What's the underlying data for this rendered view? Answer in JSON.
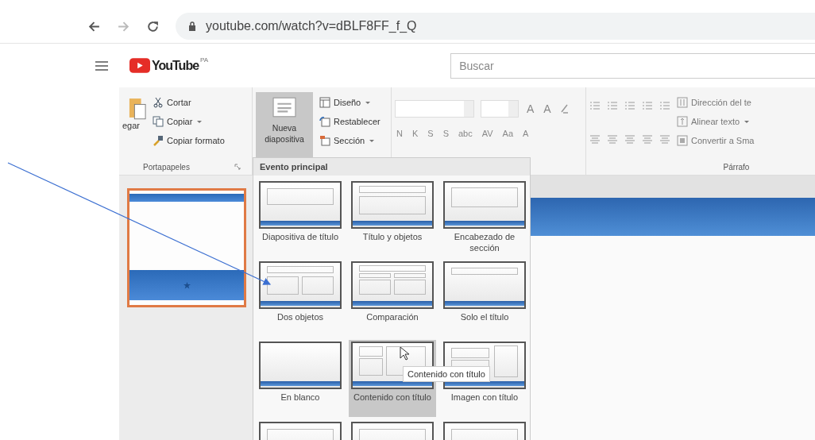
{
  "browser": {
    "url": "youtube.com/watch?v=dBLF8FF_f_Q"
  },
  "youtube": {
    "logo": "YouTube",
    "region": "PA",
    "search": {
      "placeholder": "Buscar"
    }
  },
  "video": {
    "ribbon": {
      "clipboard": {
        "paste_label": "egar",
        "title": "Portapapeles",
        "items": [
          {
            "label": "Cortar",
            "kind": "cut",
            "dropdown": false
          },
          {
            "label": "Copiar",
            "kind": "copy",
            "dropdown": true
          },
          {
            "label": "Copiar formato",
            "kind": "brush",
            "dropdown": false
          }
        ]
      },
      "slides": {
        "new_slide": {
          "label": "Nueva diapositiva",
          "active": true
        },
        "items": [
          {
            "label": "Diseño",
            "kind": "layout",
            "dropdown": true
          },
          {
            "label": "Restablecer",
            "kind": "reset",
            "dropdown": false
          },
          {
            "label": "Sección",
            "kind": "section",
            "dropdown": true
          }
        ]
      },
      "font": {
        "size_buttons": [
          "A",
          "A"
        ],
        "format_buttons": [
          "N",
          "K",
          "S",
          "S",
          "abc",
          "AV",
          "Aa",
          "A"
        ]
      },
      "paragraph": {
        "title": "Párrafo",
        "commands": [
          {
            "label": "Dirección del te",
            "kind": "direction",
            "dropdown": false
          },
          {
            "label": "Alinear texto",
            "kind": "align",
            "dropdown": true
          },
          {
            "label": "Convertir a Sma",
            "kind": "smartart",
            "dropdown": false
          }
        ]
      }
    },
    "slide_panel": {
      "thumbnails": [
        {
          "selected": true
        }
      ]
    },
    "gallery": {
      "heading": "Evento principal",
      "tooltip": "Contenido con título",
      "layouts": [
        {
          "label": "Diapositiva de título",
          "kind": "title",
          "selected": false
        },
        {
          "label": "Título y objetos",
          "kind": "title-content",
          "selected": false
        },
        {
          "label": "Encabezado de sección",
          "kind": "section",
          "selected": false
        },
        {
          "label": "Dos objetos",
          "kind": "two-content",
          "selected": false
        },
        {
          "label": "Comparación",
          "kind": "comparison",
          "selected": false
        },
        {
          "label": "Solo el título",
          "kind": "title-only",
          "selected": false
        },
        {
          "label": "En blanco",
          "kind": "blank",
          "selected": false
        },
        {
          "label": "Contenido con título",
          "kind": "content-caption",
          "selected": true
        },
        {
          "label": "Imagen con título",
          "kind": "picture-caption",
          "selected": false
        },
        {
          "kind": "unlabeled",
          "selected": false
        },
        {
          "kind": "unlabeled",
          "selected": false
        },
        {
          "kind": "unlabeled",
          "selected": false
        }
      ]
    }
  }
}
